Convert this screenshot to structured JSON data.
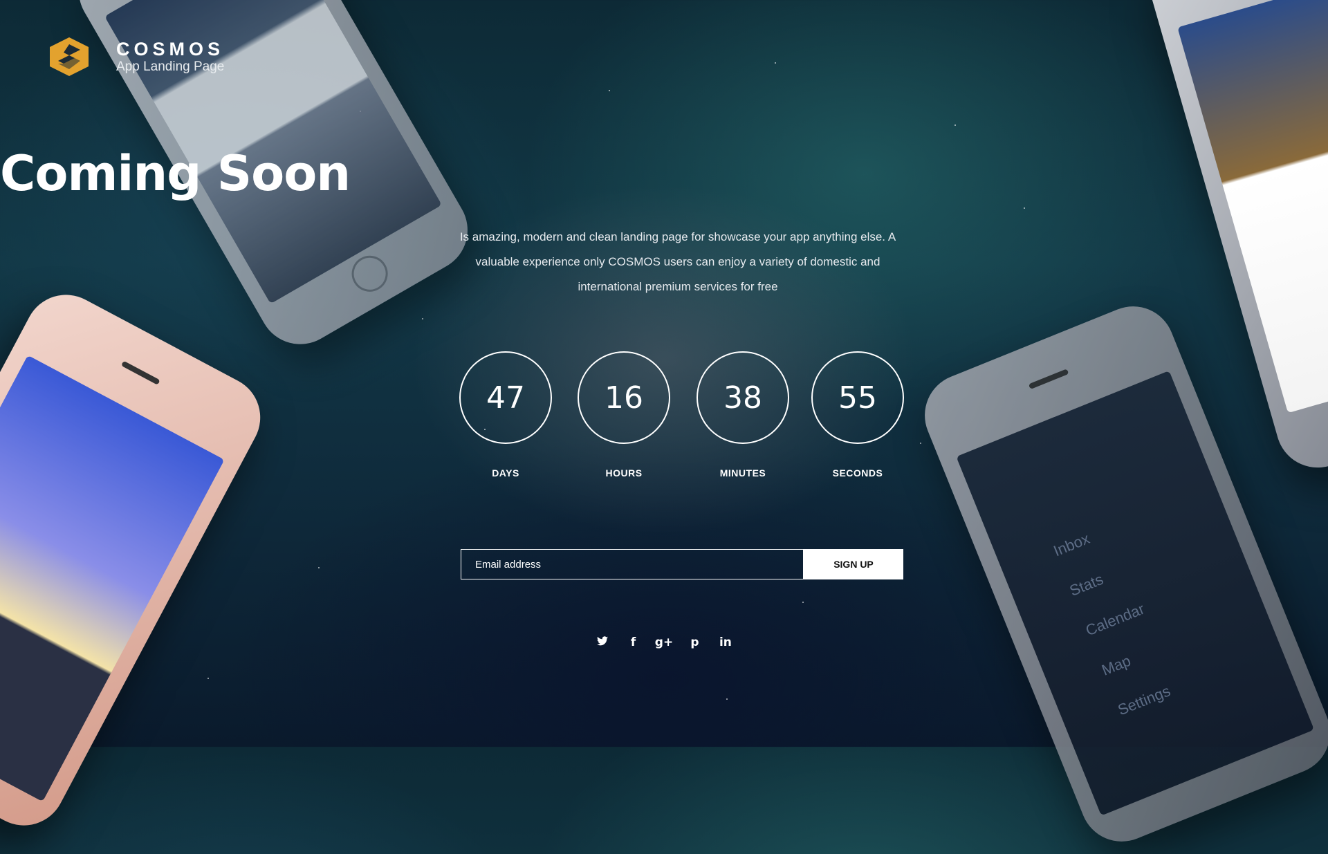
{
  "brand": {
    "name": "COSMOS",
    "tagline": "App Landing Page",
    "logo_color": "#e3a22e"
  },
  "hero": {
    "title": "Coming Soon",
    "description": "Is amazing, modern and clean landing page for showcase your app anything else. A valuable experience only COSMOS users can enjoy a variety of domestic and international premium services for free"
  },
  "countdown": [
    {
      "value": "47",
      "label": "DAYS"
    },
    {
      "value": "16",
      "label": "HOURS"
    },
    {
      "value": "38",
      "label": "MINUTES"
    },
    {
      "value": "55",
      "label": "SECONDS"
    }
  ],
  "signup_form": {
    "email_placeholder": "Email address",
    "button_label": "SIGN UP"
  },
  "social": [
    {
      "icon": "twitter-icon",
      "glyph": "🐦"
    },
    {
      "icon": "facebook-icon",
      "glyph": "f"
    },
    {
      "icon": "google-plus-icon",
      "glyph": "g+"
    },
    {
      "icon": "pinterest-icon",
      "glyph": "p"
    },
    {
      "icon": "linkedin-icon",
      "glyph": "in"
    }
  ],
  "phone_menu": [
    "Inbox",
    "Stats",
    "Calendar",
    "Map",
    "Settings"
  ]
}
